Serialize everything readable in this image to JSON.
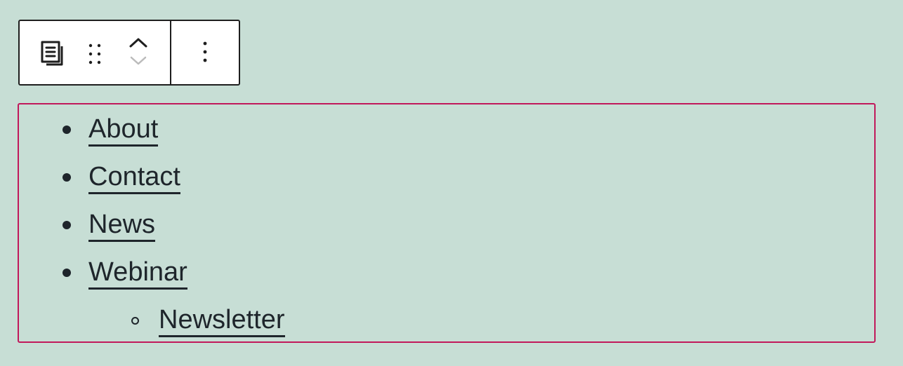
{
  "toolbar": {
    "block_type_icon": "navigation-list-icon",
    "drag_icon": "drag-handle-icon",
    "move_up_icon": "chevron-up-icon",
    "move_down_icon": "chevron-down-icon",
    "options_icon": "more-vertical-icon"
  },
  "colors": {
    "background": "#c7ded5",
    "selection_border": "#c1185b",
    "text": "#1e252b",
    "toolbar_border": "#1e1e1e"
  },
  "navigation": {
    "items": [
      {
        "label": "About"
      },
      {
        "label": "Contact"
      },
      {
        "label": "News"
      },
      {
        "label": "Webinar",
        "children": [
          {
            "label": "Newsletter"
          }
        ]
      }
    ]
  }
}
